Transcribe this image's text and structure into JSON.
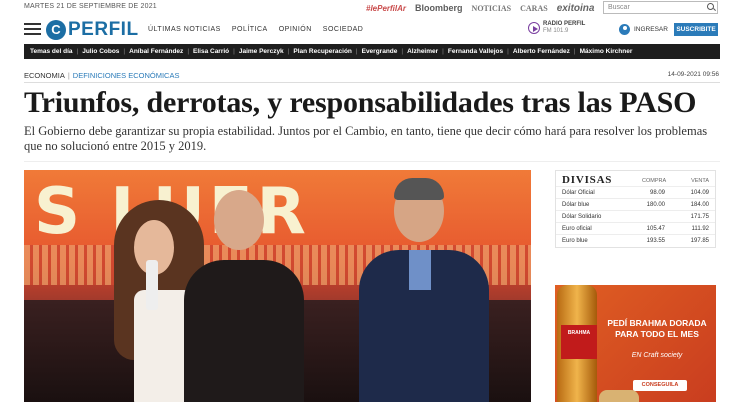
{
  "topbar": {
    "date": "MARTES 21 DE SEPTIEMBRE DE 2021",
    "partners": [
      "#lePerfilAr",
      "Bloomberg",
      "NOTICIAS",
      "CARAS",
      "exitoina"
    ],
    "search_placeholder": "Buscar"
  },
  "header": {
    "logo_letter": "C",
    "logo_text": "PERFIL",
    "nav": [
      "ÚLTIMAS NOTICIAS",
      "POLÍTICA",
      "OPINIÓN",
      "SOCIEDAD"
    ],
    "radio": {
      "name": "RADIO PERFIL",
      "freq": "FM 101.9"
    },
    "login_label": "INGRESAR",
    "subscribe_label": "SUSCRIBITE"
  },
  "topics": [
    "Temas del día",
    "Julio Cobos",
    "Aníbal Fernández",
    "Elisa Carrió",
    "Jaime Perczyk",
    "Plan Recuperación",
    "Evergrande",
    "Alzheimer",
    "Fernanda Vallejos",
    "Alberto Fernández",
    "Máximo Kirchner"
  ],
  "article": {
    "section": "ECONOMIA",
    "subsection": "DEFINICIONES ECONÓMICAS",
    "timestamp": "14-09-2021 09:56",
    "title": "Triunfos, derrotas, y responsabilidades tras las PASO",
    "lead": "El Gobierno debe garantizar su propia estabilidad. Juntos por el Cambio, en tanto, tiene que decir cómo hará para resolver los problemas que no solucionó entre 2015 y 2019.",
    "photo_sign_text": "S LUER"
  },
  "divisas": {
    "title": "DIVISAS",
    "col_buy": "COMPRA",
    "col_sell": "VENTA",
    "rows": [
      {
        "name": "Dólar Oficial",
        "buy": "98.09",
        "sell": "104.09"
      },
      {
        "name": "Dólar blue",
        "buy": "180.00",
        "sell": "184.00"
      },
      {
        "name": "Dólar Solidario",
        "buy": "",
        "sell": "171.75"
      },
      {
        "name": "Euro oficial",
        "buy": "105.47",
        "sell": "111.92"
      },
      {
        "name": "Euro blue",
        "buy": "193.55",
        "sell": "197.85"
      }
    ]
  },
  "ad": {
    "bottle_brand": "BRAHMA",
    "headline": "PEDÍ BRAHMA DORADA PARA TODO EL MES",
    "sub": "EN Craft society",
    "button": "CONSEGUILA"
  }
}
